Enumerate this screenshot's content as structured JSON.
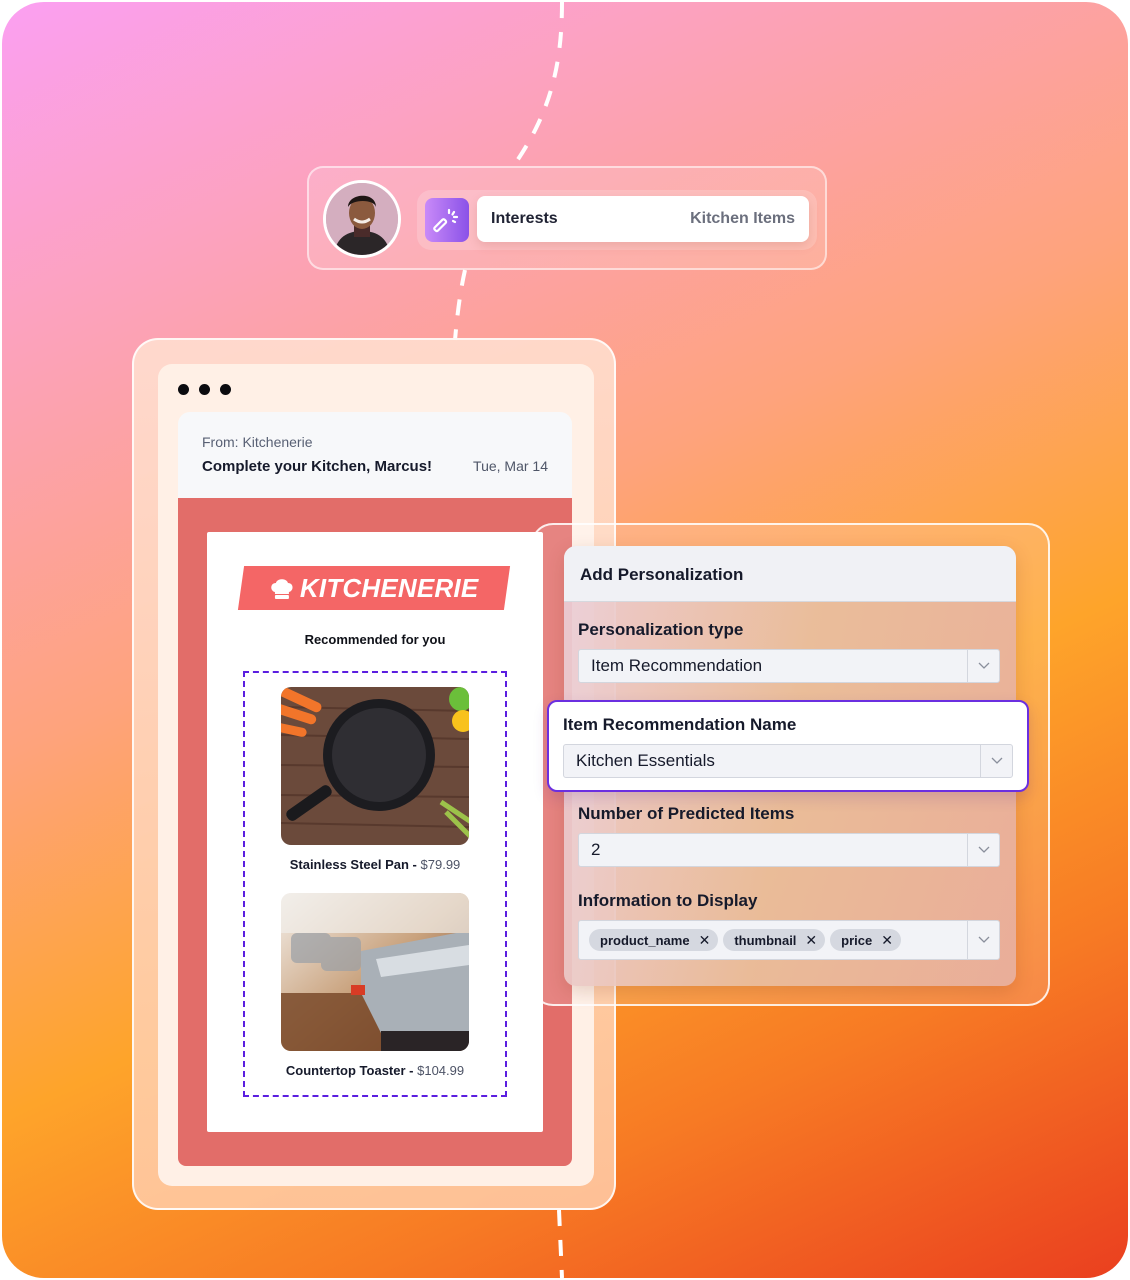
{
  "profile": {
    "avatar_alt": "User avatar",
    "attribute_icon": "magic-wand-icon",
    "attribute_label": "Interests",
    "attribute_value": "Kitchen Items"
  },
  "email": {
    "window_controls": [
      "dot",
      "dot",
      "dot"
    ],
    "from": "From: Kitchenerie",
    "subject": "Complete your Kitchen, Marcus!",
    "date": "Tue, Mar 14",
    "brand": {
      "icon": "chef-hat-icon",
      "name": "KITCHENERIE",
      "color": "#f46666"
    },
    "recommended_title": "Recommended for you",
    "products": [
      {
        "name": "Stainless Steel Pan -",
        "price": "$79.99",
        "image": "frying-pan-photo"
      },
      {
        "name": "Countertop Toaster -",
        "price": "$104.99",
        "image": "toaster-photo"
      }
    ]
  },
  "personalization": {
    "title": "Add Personalization",
    "fields": {
      "type": {
        "label": "Personalization type",
        "value": "Item Recommendation"
      },
      "name": {
        "label": "Item Recommendation Name",
        "value": "Kitchen Essentials"
      },
      "count": {
        "label": "Number of Predicted Items",
        "value": "2"
      },
      "display": {
        "label": "Information to Display",
        "tags": [
          "product_name",
          "thumbnail",
          "price"
        ]
      }
    },
    "accent_color": "#6b2fe0"
  }
}
